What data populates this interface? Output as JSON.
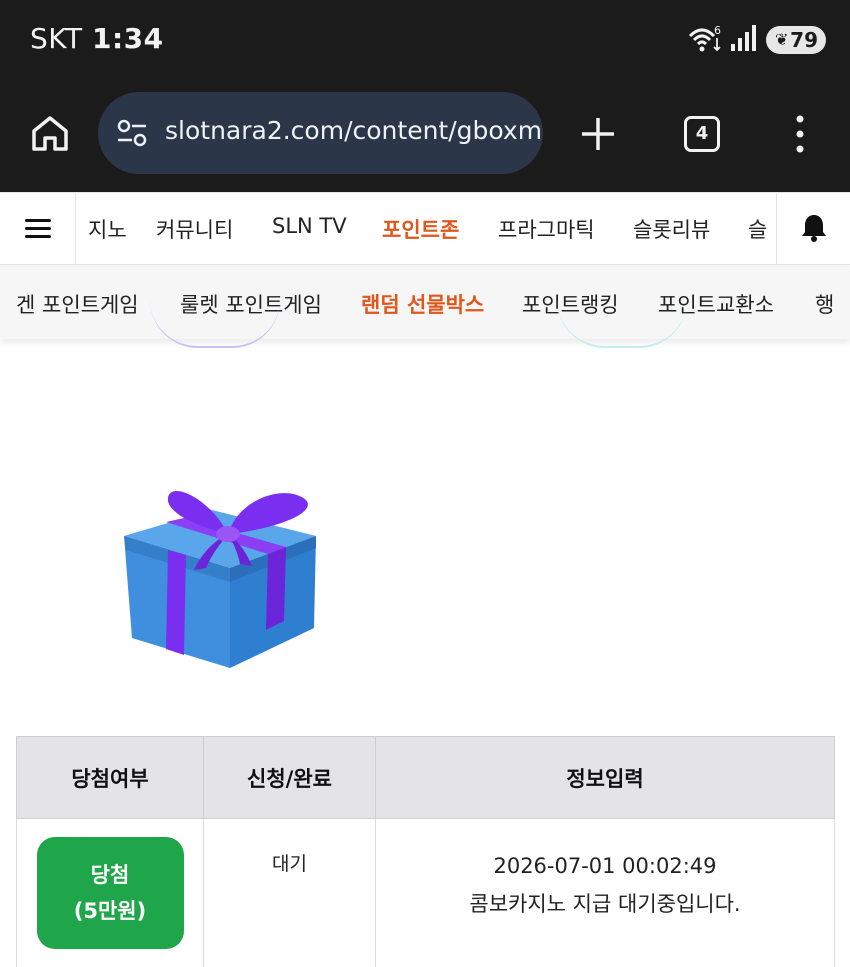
{
  "status_bar": {
    "carrier": "SKT",
    "time": "1:34",
    "wifi_badge": "6",
    "battery": "79"
  },
  "browser": {
    "url": "slotnara2.com/content/gboxm",
    "tab_count": "4"
  },
  "primary_nav": {
    "items": [
      "지노",
      "커뮤니티",
      "SLN TV",
      "포인트존",
      "프라그마틱",
      "슬롯리뷰",
      "슬"
    ],
    "active": "포인트존"
  },
  "secondary_nav": {
    "items": [
      "겐 포인트게임",
      "룰렛 포인트게임",
      "랜덤 선물박스",
      "포인트랭킹",
      "포인트교환소",
      "행"
    ],
    "active": "랜덤 선물박스"
  },
  "result_table": {
    "headers": [
      "당첨여부",
      "신청/완료",
      "정보입력"
    ],
    "row": {
      "win_label_line1": "당첨",
      "win_label_line2": "(5만원)",
      "status": "대기",
      "info_line1": "2026-07-01 00:02:49",
      "info_line2": "콤보카지노 지급 대기중입니다."
    }
  },
  "colors": {
    "accent": "#e0561b",
    "win_button": "#1fa64a",
    "gift_box": "#3f8fde",
    "ribbon": "#7a2ff0"
  }
}
